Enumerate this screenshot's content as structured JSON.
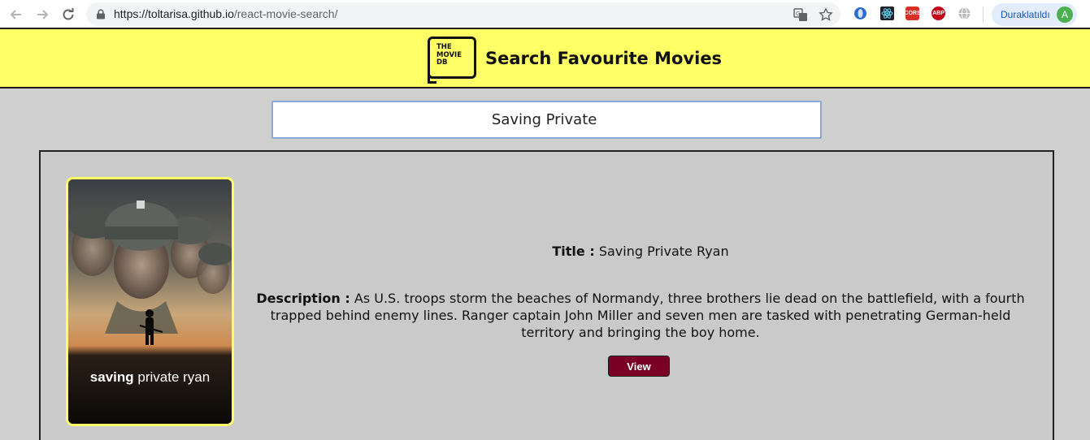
{
  "browser": {
    "url_host": "https://toltarisa.github.io",
    "url_path": "/react-movie-search/",
    "profile_label": "Duraklatıldı",
    "avatar_letter": "A",
    "extensions": [
      "translate-icon",
      "star-bookmark-icon",
      "opera-icon",
      "react-devtools-icon",
      "cors-icon",
      "adblock-plus-icon",
      "globe-icon"
    ],
    "ext_labels": {
      "cors": "CORS",
      "abp": "ABP"
    }
  },
  "header": {
    "logo_lines": [
      "THE",
      "MOVIE",
      "DB"
    ],
    "title": "Search Favourite Movies",
    "accent": "#ffff66"
  },
  "search": {
    "value": "Saving Private "
  },
  "result": {
    "poster_caption_bold": "saving",
    "poster_caption_rest": " private ryan",
    "title_label": "Title :",
    "title_value": " Saving Private Ryan",
    "description_label": "Description :",
    "description_value": " As U.S. troops storm the beaches of Normandy, three brothers lie dead on the battlefield, with a fourth trapped behind enemy lines. Ranger captain John Miller and seven men are tasked with penetrating German-held territory and bringing the boy home.",
    "view_label": "View",
    "button_color": "#7a0026"
  }
}
